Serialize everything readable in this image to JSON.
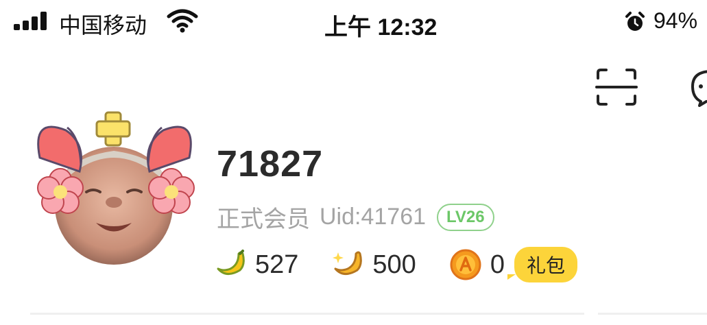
{
  "status_bar": {
    "carrier": "中国移动",
    "time": "上午 12:32",
    "battery": "94%"
  },
  "profile": {
    "username": "71827",
    "member_type": "正式会员",
    "uid": "Uid:41761",
    "level": "LV26"
  },
  "stats": {
    "banana": "527",
    "gold_banana": "500",
    "coin": "0",
    "gift_label": "礼包"
  },
  "colors": {
    "level_green": "#6cc768",
    "gift_yellow": "#fcd43a",
    "banana_yellow": "#f5c518"
  }
}
